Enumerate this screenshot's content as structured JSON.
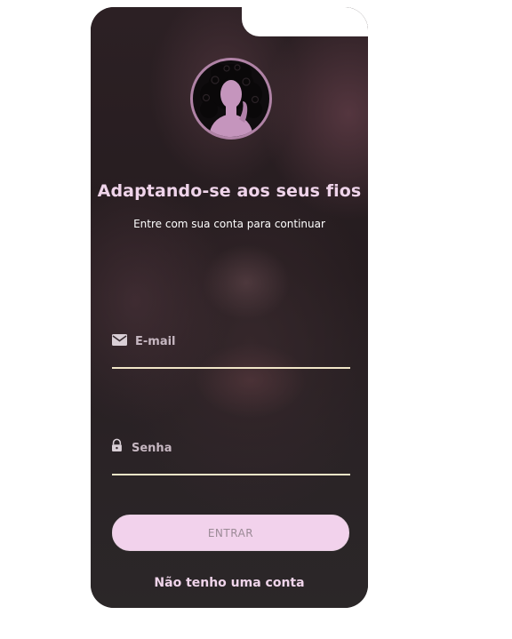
{
  "app": {
    "title": "Adaptando-se aos seus fios",
    "subtitle": "Entre com sua conta para continuar"
  },
  "logo": {
    "icon": "woman-silhouette-icon",
    "ring_color": "#b083a6",
    "figure_color": "#c595bd"
  },
  "form": {
    "email": {
      "icon": "mail-icon",
      "placeholder": "E-mail",
      "value": ""
    },
    "password": {
      "icon": "lock-icon",
      "placeholder": "Senha",
      "value": ""
    },
    "submit_label": "ENTRAR"
  },
  "footer": {
    "register_link": "Não tenho uma conta"
  },
  "colors": {
    "accent": "#efd4ea",
    "button_bg": "#f2d2ec",
    "underline": "#f1e6c8",
    "background": "#231a1d"
  }
}
